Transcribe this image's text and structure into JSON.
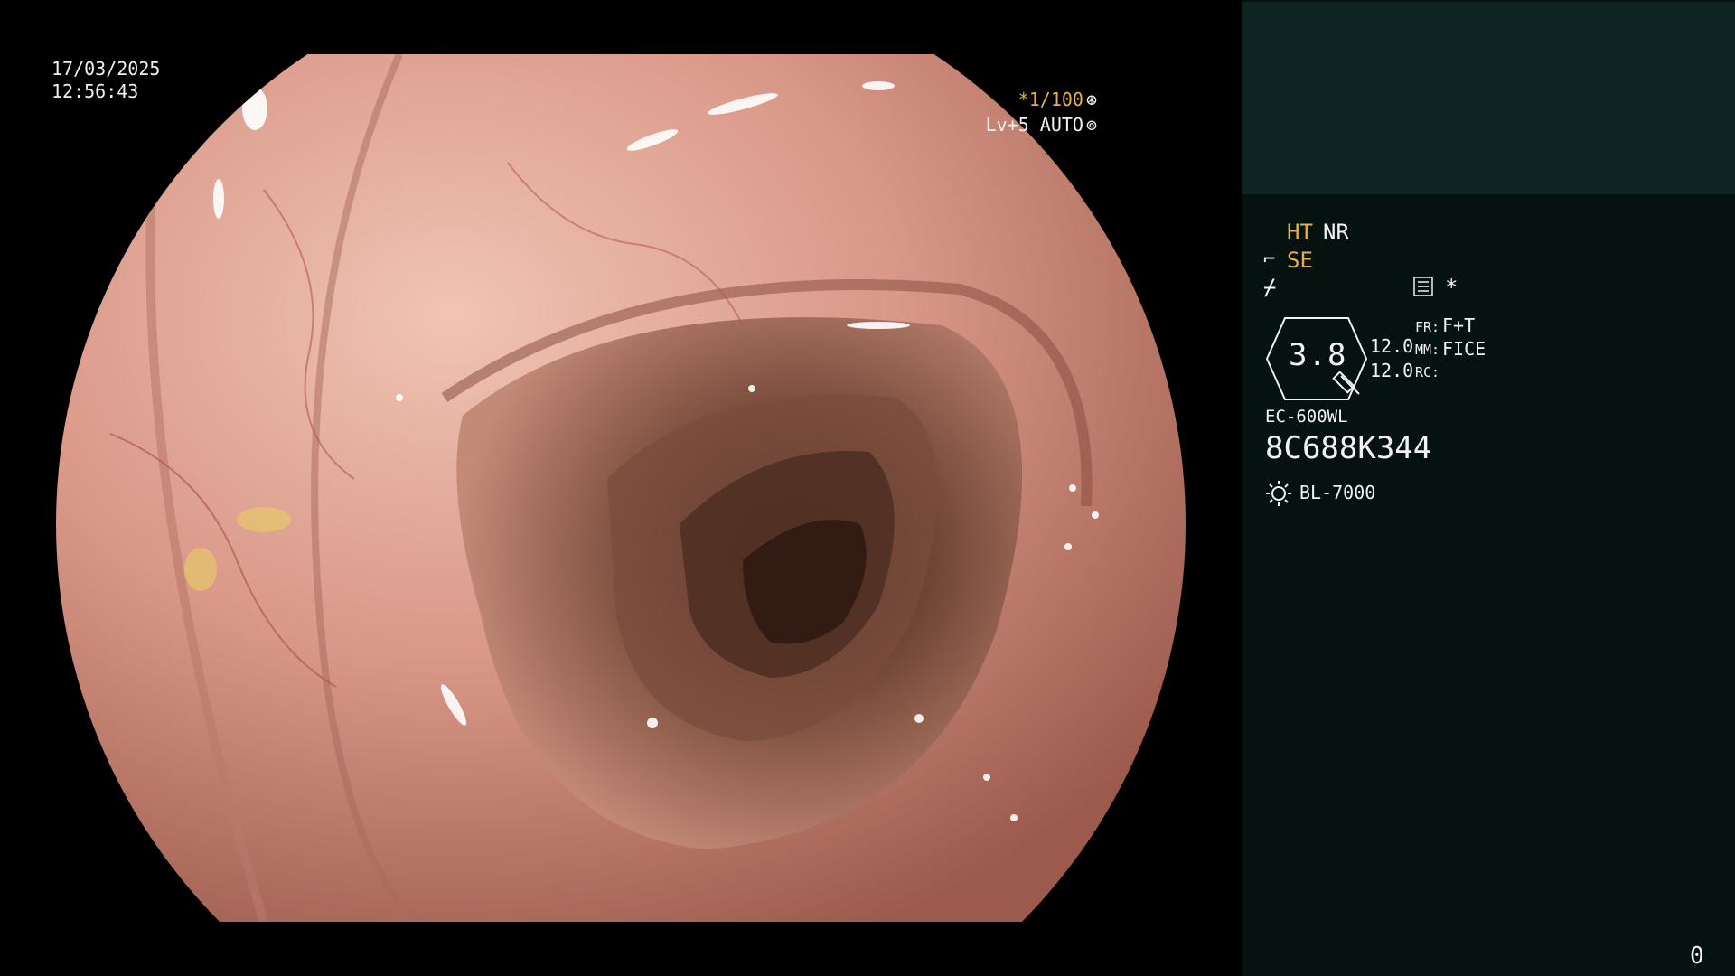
{
  "overlay": {
    "date": "17/03/2025",
    "time": "12:56:43",
    "shutter": "*1/100",
    "shutter_icon": "aperture-icon",
    "gain": "Lv+5 AUTO",
    "gain_icon": "iris-icon"
  },
  "panel": {
    "mode_ht": "HT",
    "mode_nr": "NR",
    "mode_se": "SE",
    "se_icon_glyph": "⌐",
    "enh_icon_glyph": "⌿",
    "star": "*",
    "zoom": "3.8",
    "value_top": "12.0",
    "value_bottom": "12.0",
    "fr_label": "FR:",
    "fr_value": "F+T",
    "mm_label": "MM:",
    "mm_value": "FICE",
    "rc_label": "RC:",
    "scope_model": "EC-600WL",
    "scope_serial": "8C688K344",
    "light_source": "BL-7000",
    "counter": "0"
  },
  "colors": {
    "background": "#000000",
    "panel": "#051210",
    "panel_top": "#0d2422",
    "accent_amber": "#e8b040",
    "text": "#f2f2f2"
  }
}
